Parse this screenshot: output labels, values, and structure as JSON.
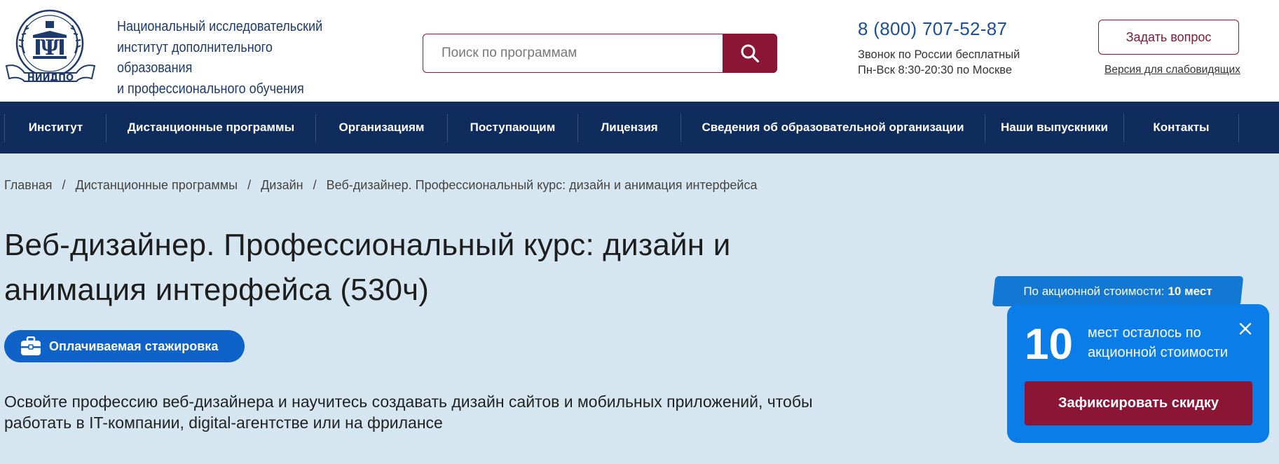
{
  "header": {
    "logo_text": "НИИДПО",
    "org_name_line1": "Национальный исследовательский",
    "org_name_line2": "институт дополнительного образования",
    "org_name_line3": "и профессионального обучения",
    "search_placeholder": "Поиск по программам",
    "phone": "8 (800) 707-52-87",
    "phone_note_line1": "Звонок по России бесплатный",
    "phone_note_line2": "Пн-Вск 8:30-20:30 по Москве",
    "ask_button": "Задать вопрос",
    "low_vision_link": "Версия для слабовидящих",
    "icons": {
      "search": "search-icon",
      "logo": "institute-emblem"
    },
    "colors": {
      "brand_red": "#8a1535",
      "brand_blue": "#1b4f96"
    }
  },
  "nav": {
    "items": [
      {
        "label": "Институт"
      },
      {
        "label": "Дистанционные программы"
      },
      {
        "label": "Организациям"
      },
      {
        "label": "Поступающим"
      },
      {
        "label": "Лицензия"
      },
      {
        "label": "Сведения об образовательной организации"
      },
      {
        "label": "Наши выпускники"
      },
      {
        "label": "Контакты"
      }
    ],
    "background": "#0f2c5d"
  },
  "breadcrumb": {
    "items": [
      "Главная",
      "Дистанционные программы",
      "Дизайн"
    ],
    "separator": "/",
    "current": "Веб-дизайнер. Профессиональный курс: дизайн и анимация интерфейса"
  },
  "main": {
    "title_line1": "Веб-дизайнер. Профессиональный курс: дизайн и",
    "title_line2": "анимация интерфейса (530ч)",
    "internship_badge": "Оплачиваемая стажировка",
    "description_line1": "Освойте профессию веб-дизайнера и научитесь создавать дизайн сайтов и мобильных приложений, чтобы",
    "description_line2": "работать в IT-компании, digital-агентстве или на фрилансе"
  },
  "promo": {
    "tag_text": "По акционной стоимости:",
    "tag_bold": "10 мест",
    "count": "10",
    "text_line1": "мест осталось по",
    "text_line2": "акционной стоимости",
    "button": "Зафиксировать скидку",
    "icons": {
      "close": "close-icon",
      "badge": "briefcase-icon"
    }
  }
}
